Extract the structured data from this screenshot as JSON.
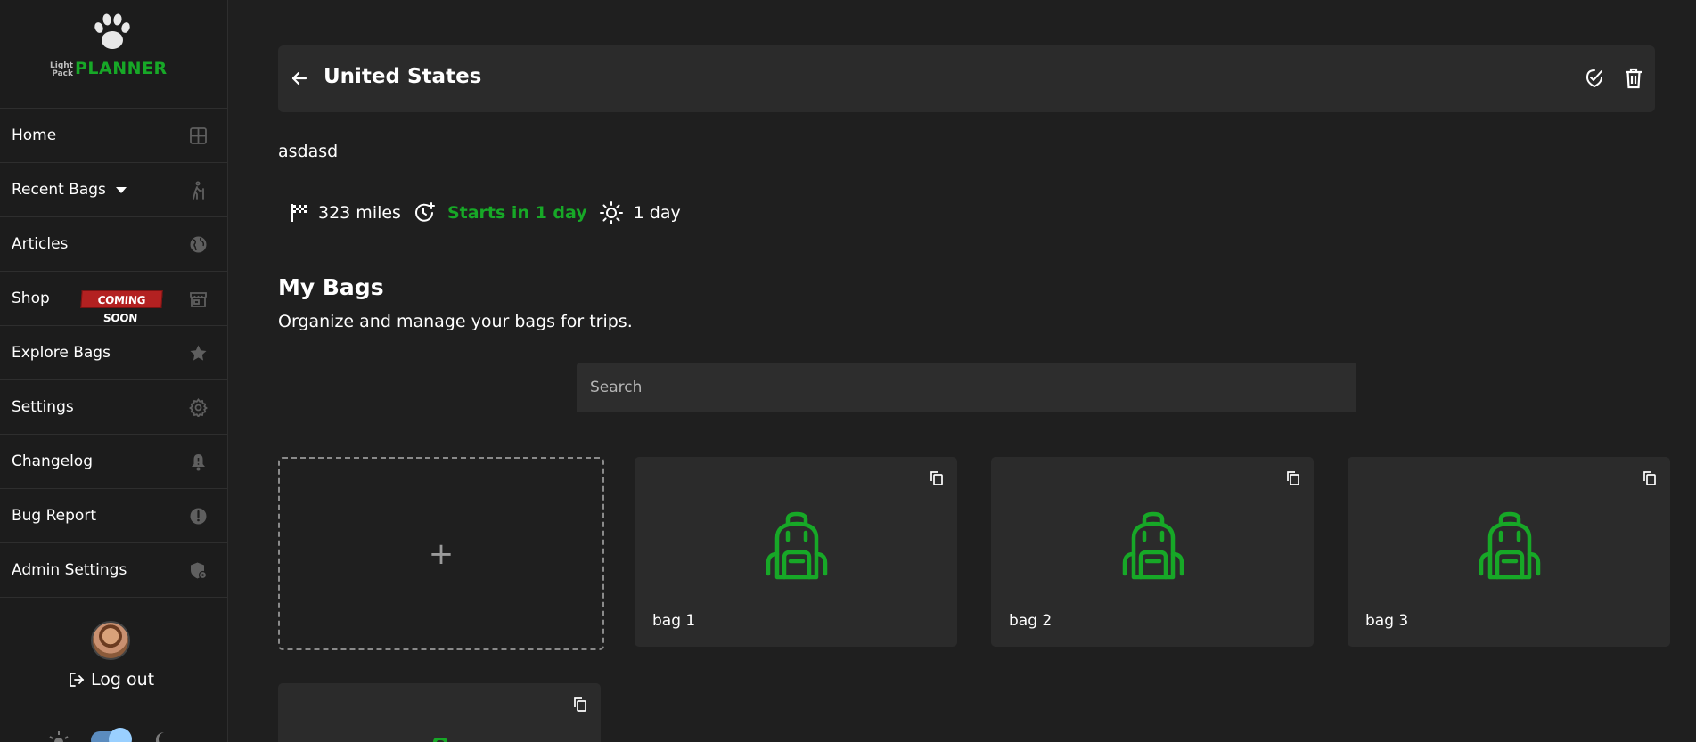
{
  "logo": {
    "small_text": "Light Pack",
    "big_text": "PLANNER"
  },
  "nav": [
    {
      "label": "Home",
      "icon": "grid-icon"
    },
    {
      "label": "Recent Bags",
      "icon": "hiker-icon",
      "dropdown": true
    },
    {
      "label": "Articles",
      "icon": "globe-icon"
    },
    {
      "label": "Shop",
      "icon": "store-icon",
      "badge": "COMING SOON"
    },
    {
      "label": "Explore Bags",
      "icon": "star-icon"
    },
    {
      "label": "Settings",
      "icon": "gear-icon"
    },
    {
      "label": "Changelog",
      "icon": "bell-icon"
    },
    {
      "label": "Bug Report",
      "icon": "alert-icon"
    },
    {
      "label": "Admin Settings",
      "icon": "shield-icon"
    }
  ],
  "account": {
    "logout_label": "Log out"
  },
  "trip": {
    "title": "United States",
    "description": "asdasd",
    "distance": "323 miles",
    "start_status": "Starts in 1 day",
    "duration": "1 day"
  },
  "bags_section": {
    "heading": "My Bags",
    "subheading": "Organize and manage your bags for trips.",
    "search_placeholder": "Search",
    "add_symbol": "+",
    "bags": [
      {
        "name": "bag 1"
      },
      {
        "name": "bag 2"
      },
      {
        "name": "bag 3"
      }
    ]
  },
  "colors": {
    "accent": "#17a827",
    "background": "#1f1f1f",
    "card": "#2b2b2b",
    "badge": "#b32121"
  }
}
